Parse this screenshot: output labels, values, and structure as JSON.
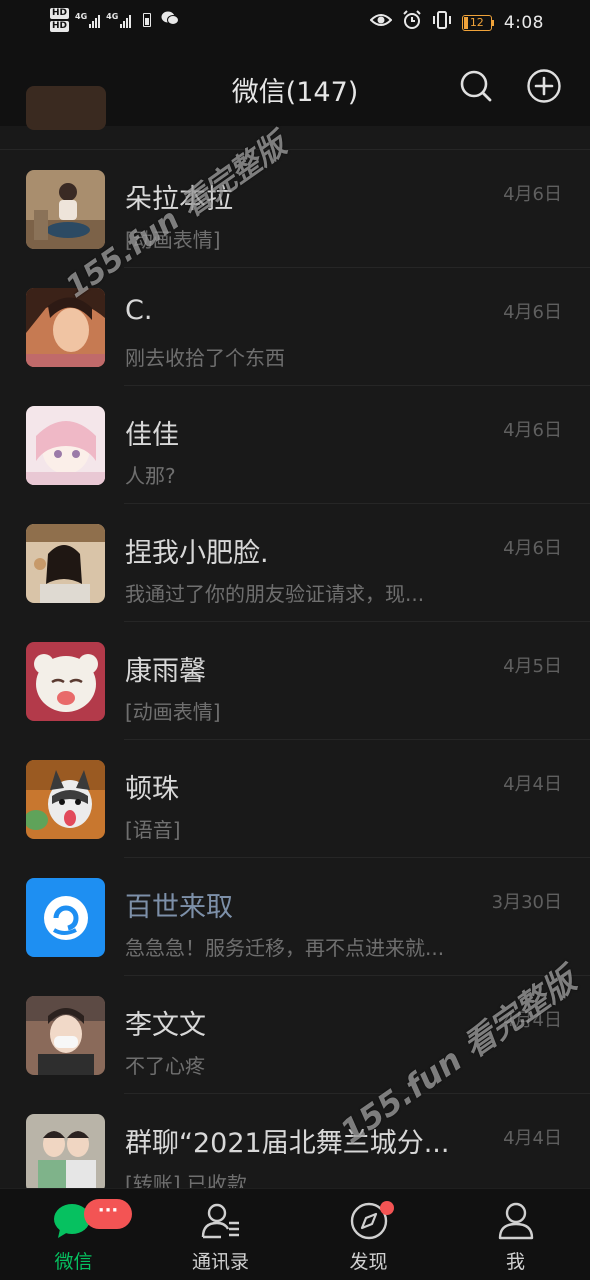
{
  "status_bar": {
    "hd1": "HD",
    "hd2": "HD",
    "net1": "4G",
    "net2": "4G",
    "battery_level": "12",
    "time": "4:08"
  },
  "header": {
    "title": "微信(147)"
  },
  "chats": [
    {
      "name": "朵拉本拉",
      "preview": "[动画表情]",
      "time": "4月6日"
    },
    {
      "name": "C.",
      "preview": "刚去收拾了个东西",
      "time": "4月6日"
    },
    {
      "name": "佳佳",
      "preview": "人那?",
      "time": "4月6日"
    },
    {
      "name": "捏我小肥脸.",
      "preview": "我通过了你的朋友验证请求，现...",
      "time": "4月6日"
    },
    {
      "name": "康雨馨",
      "preview": "[动画表情]",
      "time": "4月5日"
    },
    {
      "name": "顿珠",
      "preview": "[语音]",
      "time": "4月4日"
    },
    {
      "name": "百世来取",
      "preview": "急急急！服务迁移，再不点进来就...",
      "time": "3月30日"
    },
    {
      "name": "李文文",
      "preview": "不了心疼",
      "time": "4月4日"
    },
    {
      "name": "群聊“2021届北舞兰城分...",
      "preview": "[转账] 已收款",
      "time": "4月4日"
    }
  ],
  "watermarks": {
    "top": "155.fun 看完整版",
    "bottom": "155.fun 看完整版"
  },
  "tabs": [
    {
      "label": "微信",
      "badge": "···"
    },
    {
      "label": "通讯录"
    },
    {
      "label": "发现"
    },
    {
      "label": "我"
    }
  ],
  "colors": {
    "accent_green": "#06c160",
    "badge_red": "#f35454",
    "official_account_name": "#7d90a9"
  }
}
